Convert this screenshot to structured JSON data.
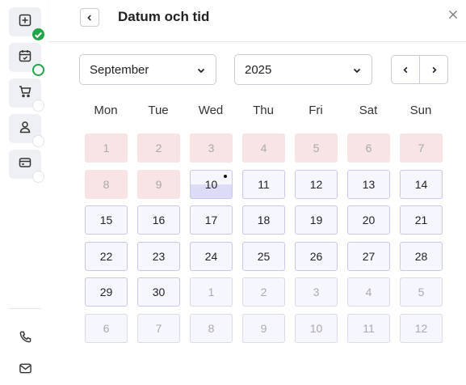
{
  "sidebar": {
    "steps": [
      {
        "icon": "plus-box-icon",
        "status": "done"
      },
      {
        "icon": "calendar-icon",
        "status": "current"
      },
      {
        "icon": "cart-icon",
        "status": "pending"
      },
      {
        "icon": "user-icon",
        "status": "pending"
      },
      {
        "icon": "card-icon",
        "status": "pending"
      }
    ],
    "footer": [
      {
        "icon": "phone-icon"
      },
      {
        "icon": "mail-icon"
      }
    ]
  },
  "header": {
    "title": "Datum och tid"
  },
  "controls": {
    "month": "September",
    "year": "2025"
  },
  "calendar": {
    "weekdays": [
      "Mon",
      "Tue",
      "Wed",
      "Thu",
      "Fri",
      "Sat",
      "Sun"
    ],
    "weeks": [
      [
        {
          "d": "1",
          "s": "past"
        },
        {
          "d": "2",
          "s": "past"
        },
        {
          "d": "3",
          "s": "past"
        },
        {
          "d": "4",
          "s": "past"
        },
        {
          "d": "5",
          "s": "past"
        },
        {
          "d": "6",
          "s": "past"
        },
        {
          "d": "7",
          "s": "past"
        }
      ],
      [
        {
          "d": "8",
          "s": "past"
        },
        {
          "d": "9",
          "s": "past"
        },
        {
          "d": "10",
          "s": "today"
        },
        {
          "d": "11",
          "s": "avail"
        },
        {
          "d": "12",
          "s": "avail"
        },
        {
          "d": "13",
          "s": "avail"
        },
        {
          "d": "14",
          "s": "avail"
        }
      ],
      [
        {
          "d": "15",
          "s": "avail"
        },
        {
          "d": "16",
          "s": "avail"
        },
        {
          "d": "17",
          "s": "avail"
        },
        {
          "d": "18",
          "s": "avail"
        },
        {
          "d": "19",
          "s": "avail"
        },
        {
          "d": "20",
          "s": "avail"
        },
        {
          "d": "21",
          "s": "avail"
        }
      ],
      [
        {
          "d": "22",
          "s": "avail"
        },
        {
          "d": "23",
          "s": "avail"
        },
        {
          "d": "24",
          "s": "avail"
        },
        {
          "d": "25",
          "s": "avail"
        },
        {
          "d": "26",
          "s": "avail"
        },
        {
          "d": "27",
          "s": "avail"
        },
        {
          "d": "28",
          "s": "avail"
        }
      ],
      [
        {
          "d": "29",
          "s": "avail"
        },
        {
          "d": "30",
          "s": "avail"
        },
        {
          "d": "1",
          "s": "other"
        },
        {
          "d": "2",
          "s": "other"
        },
        {
          "d": "3",
          "s": "other"
        },
        {
          "d": "4",
          "s": "other"
        },
        {
          "d": "5",
          "s": "other"
        }
      ],
      [
        {
          "d": "6",
          "s": "other"
        },
        {
          "d": "7",
          "s": "other"
        },
        {
          "d": "8",
          "s": "other"
        },
        {
          "d": "9",
          "s": "other"
        },
        {
          "d": "10",
          "s": "other"
        },
        {
          "d": "11",
          "s": "other"
        },
        {
          "d": "12",
          "s": "other"
        }
      ]
    ]
  },
  "colors": {
    "accent_green": "#22a447",
    "past_day_bg": "#f8e4e4",
    "available_day_bg": "#f6f6ff",
    "available_day_border": "#c9c8ee"
  }
}
